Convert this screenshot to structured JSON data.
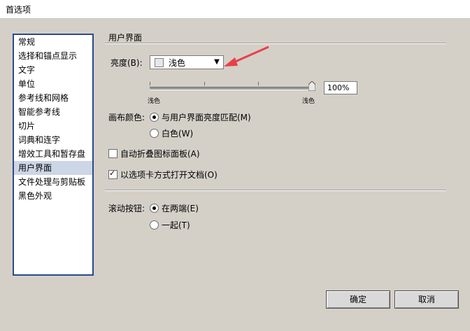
{
  "window": {
    "title": "首选项"
  },
  "sidebar": {
    "items": [
      {
        "label": "常规",
        "selected": false
      },
      {
        "label": "选择和锚点显示",
        "selected": false
      },
      {
        "label": "文字",
        "selected": false
      },
      {
        "label": "单位",
        "selected": false
      },
      {
        "label": "参考线和网格",
        "selected": false
      },
      {
        "label": "智能参考线",
        "selected": false
      },
      {
        "label": "切片",
        "selected": false
      },
      {
        "label": "词典和连字",
        "selected": false
      },
      {
        "label": "增效工具和暂存盘",
        "selected": false
      },
      {
        "label": "用户界面",
        "selected": true
      },
      {
        "label": "文件处理与剪贴板",
        "selected": false
      },
      {
        "label": "黑色外观",
        "selected": false
      }
    ]
  },
  "ui_section": {
    "title": "用户界面",
    "brightness": {
      "label": "亮度(B):",
      "selected": "浅色",
      "icon": "chevron-down-icon"
    },
    "slider": {
      "min_label": "浅色",
      "max_label": "浅色",
      "value_percent": 100,
      "value_text": "100%"
    },
    "canvas_color": {
      "label": "画布颜色:",
      "options": [
        {
          "label": "与用户界面亮度匹配(M)",
          "checked": true
        },
        {
          "label": "白色(W)",
          "checked": false
        }
      ]
    },
    "auto_collapse": {
      "label": "自动折叠图标面板(A)",
      "checked": false
    },
    "open_as_tabs": {
      "label": "以选项卡方式打开文档(O)",
      "checked": true
    },
    "scroll_buttons": {
      "label": "滚动按钮:",
      "options": [
        {
          "label": "在两端(E)",
          "checked": true
        },
        {
          "label": "一起(T)",
          "checked": false
        }
      ]
    }
  },
  "buttons": {
    "ok": "确定",
    "cancel": "取消"
  },
  "colors": {
    "accent_arrow": "#e8404a",
    "sidebar_border": "#2b4a8a",
    "selected_bg": "#cdd6e6"
  }
}
